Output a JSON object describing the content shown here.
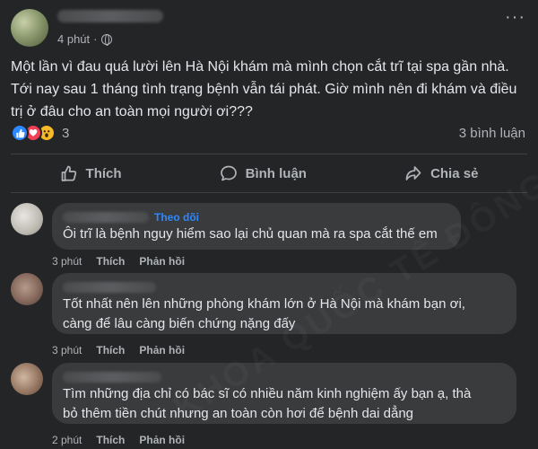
{
  "post": {
    "time": "4 phút",
    "separator": "·",
    "text": "Một lần vì đau quá lười lên Hà Nội khám mà mình chọn cắt trĩ tại spa gần nhà. Tới nay sau 1 tháng tình trạng bệnh vẫn tái phát. Giờ mình nên đi khám và điều trị ở đâu cho an toàn mọi người ơi???",
    "reaction_count": "3",
    "comment_count": "3 bình luận",
    "reactions": [
      "like-icon",
      "love-icon",
      "wow-icon"
    ]
  },
  "actions": {
    "like": "Thích",
    "comment": "Bình luận",
    "share": "Chia sẻ"
  },
  "comments": [
    {
      "follow": "Theo dõi",
      "text": "Ôi trĩ là bệnh nguy hiểm sao lại chủ quan mà ra spa cắt thế em",
      "time": "3 phút",
      "like": "Thích",
      "reply": "Phản hồi"
    },
    {
      "text_line1": "Tốt nhất nên lên những phòng khám lớn ở Hà Nội mà khám bạn ơi,",
      "text_line2": "càng để lâu càng biến chứng nặng đấy",
      "time": "3 phút",
      "like": "Thích",
      "reply": "Phản hồi"
    },
    {
      "text_line1": "Tìm những địa chỉ có bác sĩ có nhiều năm kinh nghiệm ấy bạn ạ, thà",
      "text_line2": "bỏ thêm tiền chút nhưng an toàn còn hơi để bệnh dai dẳng",
      "time": "2 phút",
      "like": "Thích",
      "reply": "Phản hồi"
    }
  ],
  "watermark": "KHOA QUỐC TẾ ĐÔNG ĐÔNG",
  "colors": {
    "background": "#242526",
    "bubble": "#3a3b3c",
    "text_primary": "#e4e6eb",
    "text_secondary": "#b0b3b8",
    "accent": "#2d88ff"
  }
}
